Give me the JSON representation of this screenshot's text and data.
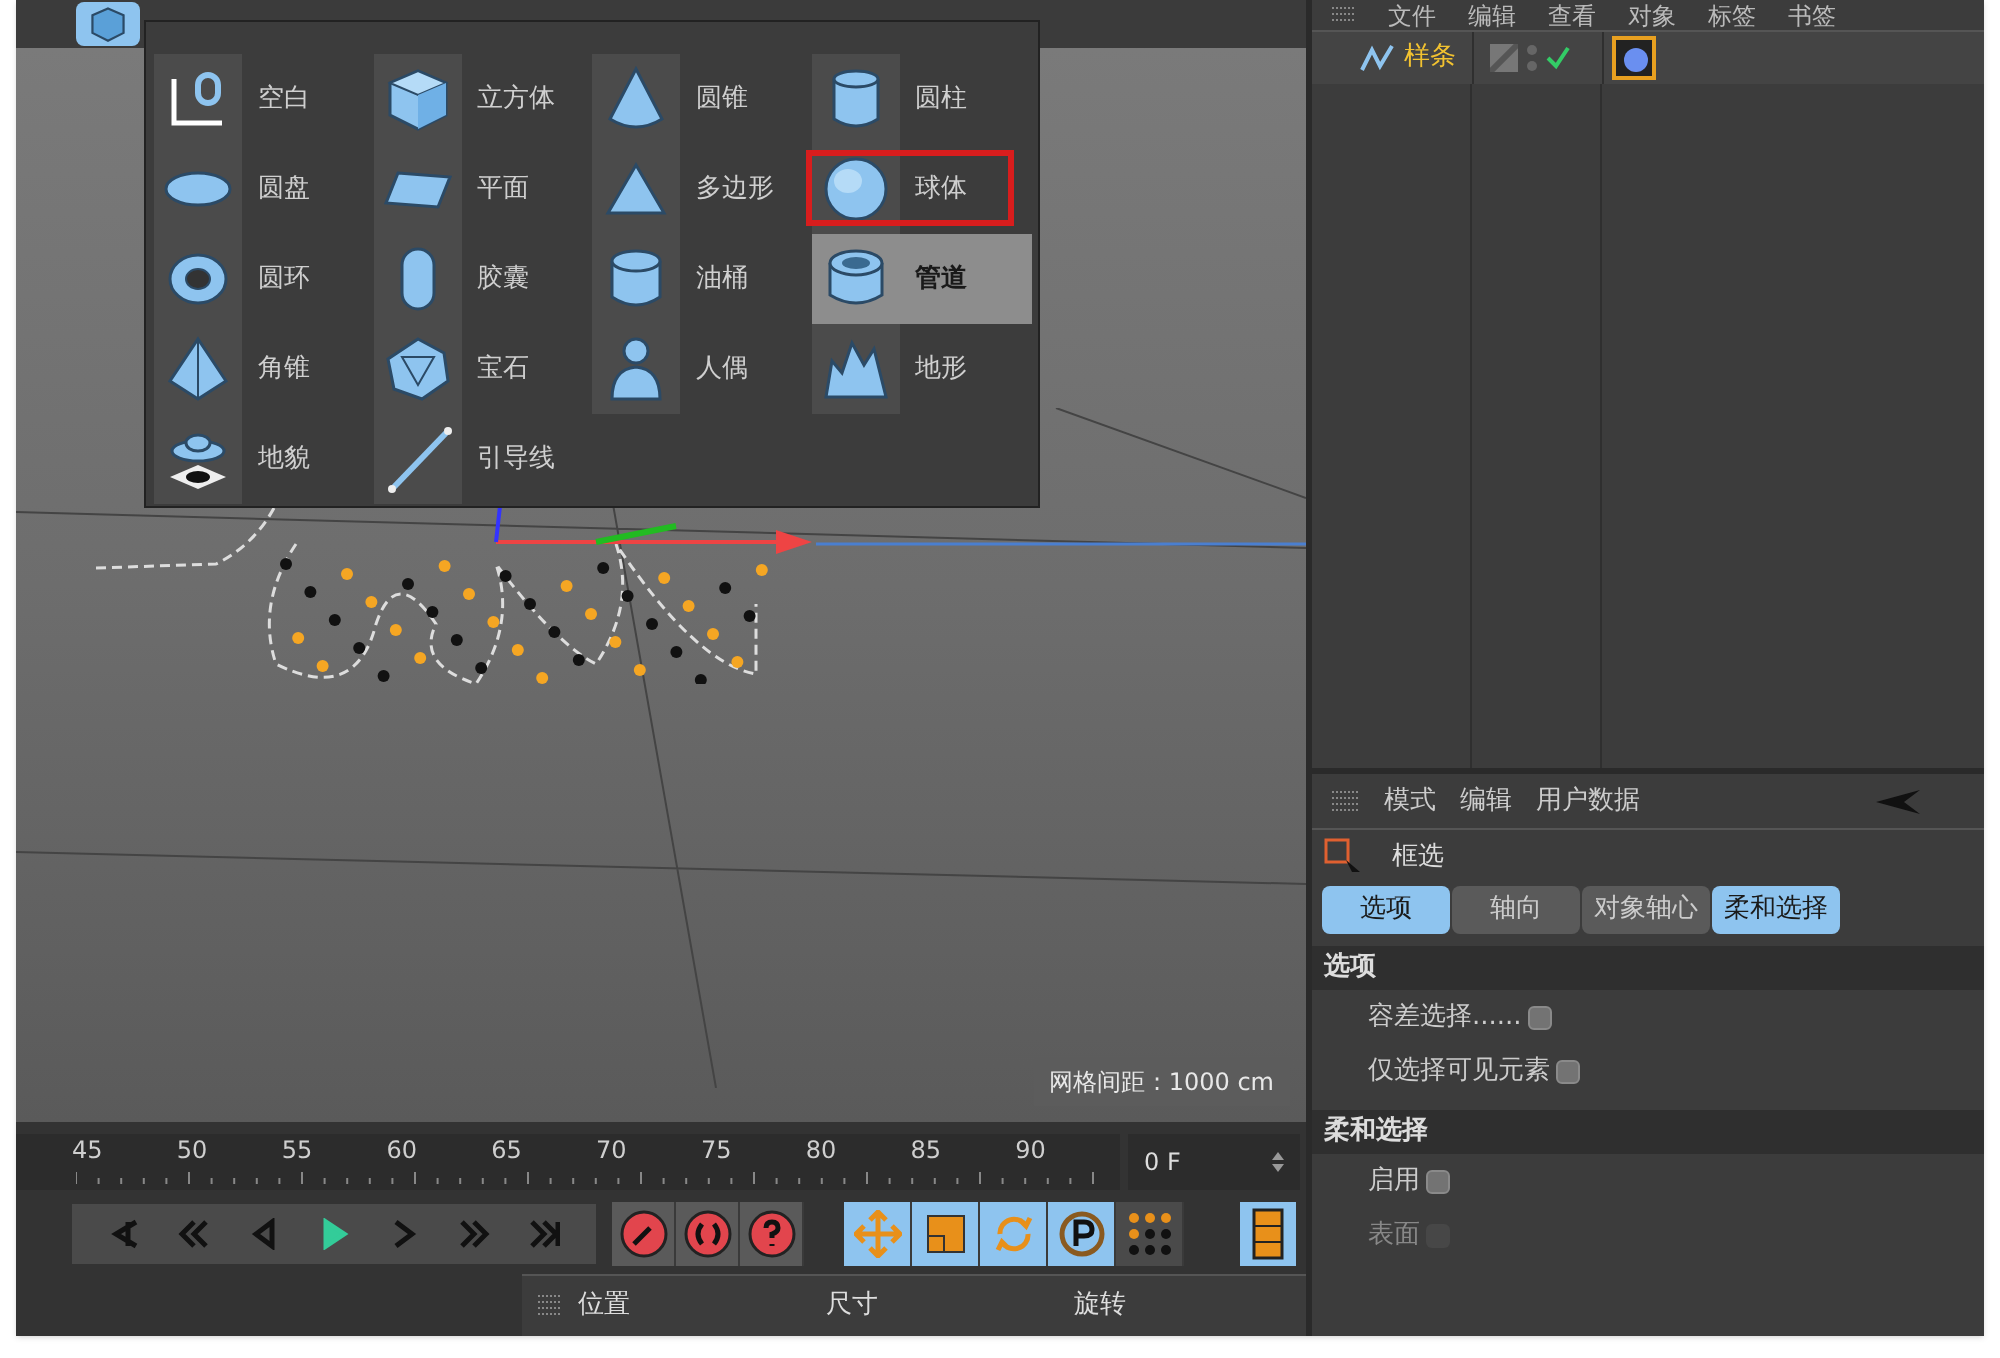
{
  "object_manager": {
    "menu": [
      "文件",
      "编辑",
      "查看",
      "对象",
      "标签",
      "书签"
    ],
    "objects": [
      {
        "name": "样条",
        "tag_selected": true
      }
    ]
  },
  "create_menu": {
    "items": [
      {
        "label": "空白",
        "kind": "null",
        "hovered": false,
        "outlined": false
      },
      {
        "label": "立方体",
        "kind": "cube",
        "hovered": false,
        "outlined": false
      },
      {
        "label": "圆锥",
        "kind": "cone",
        "hovered": false,
        "outlined": false
      },
      {
        "label": "圆柱",
        "kind": "cylinder",
        "hovered": false,
        "outlined": false
      },
      {
        "label": "圆盘",
        "kind": "disc",
        "hovered": false,
        "outlined": false
      },
      {
        "label": "平面",
        "kind": "plane",
        "hovered": false,
        "outlined": false
      },
      {
        "label": "多边形",
        "kind": "triangle",
        "hovered": false,
        "outlined": false
      },
      {
        "label": "球体",
        "kind": "sphere",
        "hovered": false,
        "outlined": true
      },
      {
        "label": "圆环",
        "kind": "torus",
        "hovered": false,
        "outlined": false
      },
      {
        "label": "胶囊",
        "kind": "capsule",
        "hovered": false,
        "outlined": false
      },
      {
        "label": "油桶",
        "kind": "barrel",
        "hovered": false,
        "outlined": false
      },
      {
        "label": "管道",
        "kind": "tube",
        "hovered": true,
        "outlined": false
      },
      {
        "label": "角锥",
        "kind": "pyramid",
        "hovered": false,
        "outlined": false
      },
      {
        "label": "宝石",
        "kind": "gem",
        "hovered": false,
        "outlined": false
      },
      {
        "label": "人偶",
        "kind": "figure",
        "hovered": false,
        "outlined": false
      },
      {
        "label": "地形",
        "kind": "landscape",
        "hovered": false,
        "outlined": false
      },
      {
        "label": "地貌",
        "kind": "relief",
        "hovered": false,
        "outlined": false
      },
      {
        "label": "引导线",
        "kind": "guide",
        "hovered": false,
        "outlined": false
      }
    ]
  },
  "viewport": {
    "grid_label": "网格间距 : 1000 cm"
  },
  "timeline": {
    "ticks": [
      "45",
      "50",
      "55",
      "60",
      "65",
      "70",
      "75",
      "80",
      "85",
      "90"
    ],
    "frame_field": "0 F"
  },
  "coordinates": {
    "columns": [
      "位置",
      "尺寸",
      "旋转"
    ]
  },
  "attributes": {
    "menu": [
      "模式",
      "编辑",
      "用户数据"
    ],
    "mode_title": "框选",
    "tabs": [
      {
        "label": "选项",
        "selected": true
      },
      {
        "label": "轴向",
        "selected": false
      },
      {
        "label": "对象轴心",
        "selected": false
      },
      {
        "label": "柔和选择",
        "selected": true
      }
    ],
    "sections": [
      {
        "title": "选项",
        "rows": [
          {
            "label": "容差选择......",
            "checked": false,
            "disabled": false
          },
          {
            "label": "仅选择可见元素",
            "checked": false,
            "disabled": false
          }
        ]
      },
      {
        "title": "柔和选择",
        "rows": [
          {
            "label": "启用",
            "checked": false,
            "disabled": false
          },
          {
            "label": "表面",
            "checked": false,
            "disabled": true
          }
        ]
      }
    ]
  }
}
